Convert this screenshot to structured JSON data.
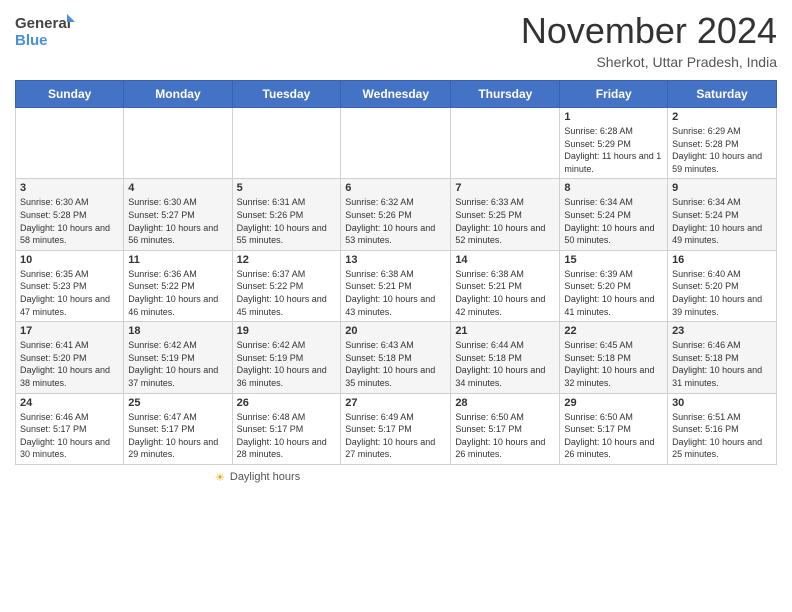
{
  "header": {
    "logo_line1": "General",
    "logo_line2": "Blue",
    "month_title": "November 2024",
    "location": "Sherkot, Uttar Pradesh, India"
  },
  "footer": {
    "daylight_label": "Daylight hours"
  },
  "weekdays": [
    "Sunday",
    "Monday",
    "Tuesday",
    "Wednesday",
    "Thursday",
    "Friday",
    "Saturday"
  ],
  "weeks": [
    [
      {
        "day": "",
        "info": ""
      },
      {
        "day": "",
        "info": ""
      },
      {
        "day": "",
        "info": ""
      },
      {
        "day": "",
        "info": ""
      },
      {
        "day": "",
        "info": ""
      },
      {
        "day": "1",
        "info": "Sunrise: 6:28 AM\nSunset: 5:29 PM\nDaylight: 11 hours and 1 minute."
      },
      {
        "day": "2",
        "info": "Sunrise: 6:29 AM\nSunset: 5:28 PM\nDaylight: 10 hours and 59 minutes."
      }
    ],
    [
      {
        "day": "3",
        "info": "Sunrise: 6:30 AM\nSunset: 5:28 PM\nDaylight: 10 hours and 58 minutes."
      },
      {
        "day": "4",
        "info": "Sunrise: 6:30 AM\nSunset: 5:27 PM\nDaylight: 10 hours and 56 minutes."
      },
      {
        "day": "5",
        "info": "Sunrise: 6:31 AM\nSunset: 5:26 PM\nDaylight: 10 hours and 55 minutes."
      },
      {
        "day": "6",
        "info": "Sunrise: 6:32 AM\nSunset: 5:26 PM\nDaylight: 10 hours and 53 minutes."
      },
      {
        "day": "7",
        "info": "Sunrise: 6:33 AM\nSunset: 5:25 PM\nDaylight: 10 hours and 52 minutes."
      },
      {
        "day": "8",
        "info": "Sunrise: 6:34 AM\nSunset: 5:24 PM\nDaylight: 10 hours and 50 minutes."
      },
      {
        "day": "9",
        "info": "Sunrise: 6:34 AM\nSunset: 5:24 PM\nDaylight: 10 hours and 49 minutes."
      }
    ],
    [
      {
        "day": "10",
        "info": "Sunrise: 6:35 AM\nSunset: 5:23 PM\nDaylight: 10 hours and 47 minutes."
      },
      {
        "day": "11",
        "info": "Sunrise: 6:36 AM\nSunset: 5:22 PM\nDaylight: 10 hours and 46 minutes."
      },
      {
        "day": "12",
        "info": "Sunrise: 6:37 AM\nSunset: 5:22 PM\nDaylight: 10 hours and 45 minutes."
      },
      {
        "day": "13",
        "info": "Sunrise: 6:38 AM\nSunset: 5:21 PM\nDaylight: 10 hours and 43 minutes."
      },
      {
        "day": "14",
        "info": "Sunrise: 6:38 AM\nSunset: 5:21 PM\nDaylight: 10 hours and 42 minutes."
      },
      {
        "day": "15",
        "info": "Sunrise: 6:39 AM\nSunset: 5:20 PM\nDaylight: 10 hours and 41 minutes."
      },
      {
        "day": "16",
        "info": "Sunrise: 6:40 AM\nSunset: 5:20 PM\nDaylight: 10 hours and 39 minutes."
      }
    ],
    [
      {
        "day": "17",
        "info": "Sunrise: 6:41 AM\nSunset: 5:20 PM\nDaylight: 10 hours and 38 minutes."
      },
      {
        "day": "18",
        "info": "Sunrise: 6:42 AM\nSunset: 5:19 PM\nDaylight: 10 hours and 37 minutes."
      },
      {
        "day": "19",
        "info": "Sunrise: 6:42 AM\nSunset: 5:19 PM\nDaylight: 10 hours and 36 minutes."
      },
      {
        "day": "20",
        "info": "Sunrise: 6:43 AM\nSunset: 5:18 PM\nDaylight: 10 hours and 35 minutes."
      },
      {
        "day": "21",
        "info": "Sunrise: 6:44 AM\nSunset: 5:18 PM\nDaylight: 10 hours and 34 minutes."
      },
      {
        "day": "22",
        "info": "Sunrise: 6:45 AM\nSunset: 5:18 PM\nDaylight: 10 hours and 32 minutes."
      },
      {
        "day": "23",
        "info": "Sunrise: 6:46 AM\nSunset: 5:18 PM\nDaylight: 10 hours and 31 minutes."
      }
    ],
    [
      {
        "day": "24",
        "info": "Sunrise: 6:46 AM\nSunset: 5:17 PM\nDaylight: 10 hours and 30 minutes."
      },
      {
        "day": "25",
        "info": "Sunrise: 6:47 AM\nSunset: 5:17 PM\nDaylight: 10 hours and 29 minutes."
      },
      {
        "day": "26",
        "info": "Sunrise: 6:48 AM\nSunset: 5:17 PM\nDaylight: 10 hours and 28 minutes."
      },
      {
        "day": "27",
        "info": "Sunrise: 6:49 AM\nSunset: 5:17 PM\nDaylight: 10 hours and 27 minutes."
      },
      {
        "day": "28",
        "info": "Sunrise: 6:50 AM\nSunset: 5:17 PM\nDaylight: 10 hours and 26 minutes."
      },
      {
        "day": "29",
        "info": "Sunrise: 6:50 AM\nSunset: 5:17 PM\nDaylight: 10 hours and 26 minutes."
      },
      {
        "day": "30",
        "info": "Sunrise: 6:51 AM\nSunset: 5:16 PM\nDaylight: 10 hours and 25 minutes."
      }
    ]
  ]
}
